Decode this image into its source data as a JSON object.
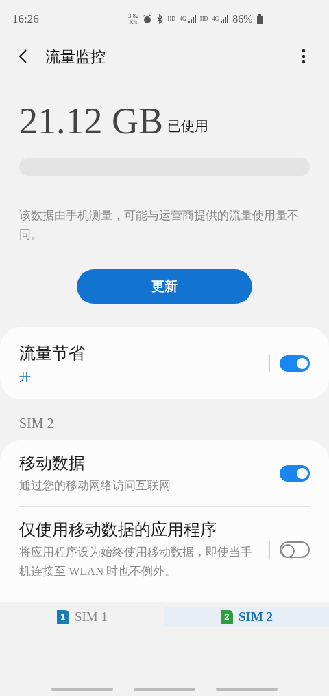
{
  "status_bar": {
    "time": "16:26",
    "speed": "3.82",
    "speed_unit": "K/s",
    "network_labels": [
      "HD",
      "4G",
      "HD",
      "4G"
    ],
    "battery": "86%"
  },
  "header": {
    "title": "流量监控"
  },
  "usage": {
    "amount": "21.12 GB",
    "suffix": "已使用",
    "note": "该数据由手机测量，可能与运营商提供的流量使用量不同。"
  },
  "update_button": "更新",
  "data_saver": {
    "title": "流量节省",
    "status": "开",
    "on": true
  },
  "section_label": "SIM 2",
  "settings": [
    {
      "title": "移动数据",
      "subtitle": "通过您的移动网络访问互联网",
      "on": true,
      "divider": false
    },
    {
      "title": "仅使用移动数据的应用程序",
      "subtitle": "将应用程序设为始终使用移动数据，即使当手机连接至 WLAN 时也不例外。",
      "on": false,
      "divider": true
    }
  ],
  "sim_tabs": [
    {
      "label": "SIM 1",
      "number": "1",
      "color": "#1a7bb5",
      "selected": false
    },
    {
      "label": "SIM 2",
      "number": "2",
      "color": "#2e9e3e",
      "selected": true
    }
  ]
}
